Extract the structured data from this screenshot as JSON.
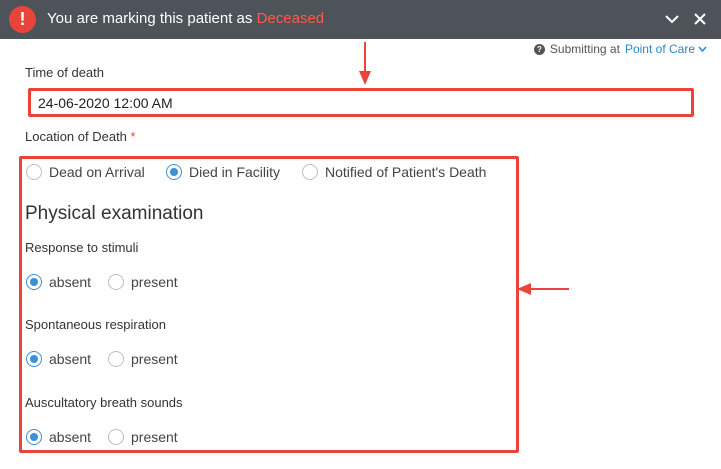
{
  "header": {
    "message_prefix": "You are marking this patient as ",
    "status": "Deceased"
  },
  "submitting": {
    "label": "Submitting at",
    "location": "Point of Care"
  },
  "time_of_death": {
    "label": "Time of death",
    "value": "24-06-2020 12:00 AM"
  },
  "location_of_death": {
    "label": "Location of Death",
    "required_mark": "*",
    "options": [
      "Dead on Arrival",
      "Died in Facility",
      "Notified of Patient's Death"
    ],
    "selected": "Died in Facility"
  },
  "physical_exam": {
    "title": "Physical examination",
    "questions": [
      {
        "label": "Response to stimuli",
        "options": [
          "absent",
          "present"
        ],
        "selected": "absent"
      },
      {
        "label": "Spontaneous respiration",
        "options": [
          "absent",
          "present"
        ],
        "selected": "absent"
      },
      {
        "label": "Auscultatory breath sounds",
        "options": [
          "absent",
          "present"
        ],
        "selected": "absent"
      }
    ]
  },
  "colors": {
    "header_bg": "#4e5259",
    "alert_red": "#e8443a",
    "radio_blue": "#3d8fd6",
    "link_blue": "#2a89c8"
  }
}
